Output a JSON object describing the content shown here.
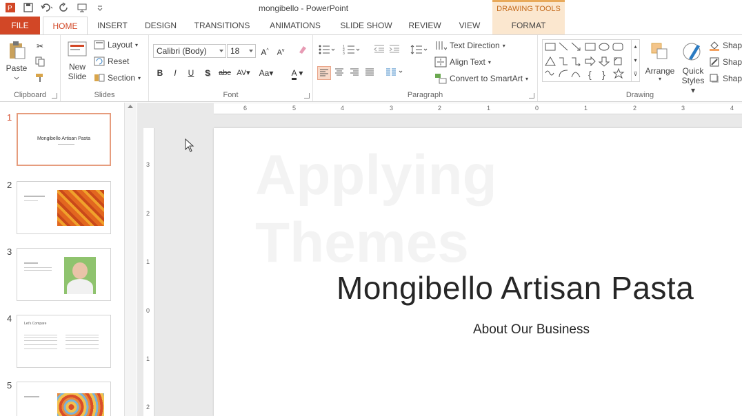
{
  "window": {
    "title": "mongibello - PowerPoint",
    "context_header": "DRAWING TOOLS"
  },
  "tabs": [
    "FILE",
    "HOME",
    "INSERT",
    "DESIGN",
    "TRANSITIONS",
    "ANIMATIONS",
    "SLIDE SHOW",
    "REVIEW",
    "VIEW",
    "FORMAT"
  ],
  "ribbon": {
    "clipboard": {
      "label": "Clipboard",
      "paste": "Paste"
    },
    "slides": {
      "label": "Slides",
      "new_slide_1": "New",
      "new_slide_2": "Slide",
      "layout": "Layout",
      "reset": "Reset",
      "section": "Section"
    },
    "font": {
      "label": "Font",
      "font_name": "Calibri (Body)",
      "font_size": "18",
      "bold": "B",
      "italic": "I",
      "underline": "U",
      "shadow": "S",
      "strike": "abc",
      "spacing": "AV",
      "case": "Aa",
      "color": "A",
      "grow": "A",
      "shrink": "A"
    },
    "paragraph": {
      "label": "Paragraph",
      "text_direction": "Text Direction",
      "align_text": "Align Text",
      "smartart": "Convert to SmartArt"
    },
    "drawing": {
      "label": "Drawing",
      "arrange": "Arrange",
      "quick_1": "Quick",
      "quick_2": "Styles",
      "shape_fill": "Shape",
      "shape_outline": "Shape",
      "shape_effects": "Shape"
    }
  },
  "thumbnails": [
    {
      "num": "1",
      "title": "Mongibello Artisan Pasta"
    },
    {
      "num": "2",
      "title": ""
    },
    {
      "num": "3",
      "title": ""
    },
    {
      "num": "4",
      "title": "Let's Compare"
    },
    {
      "num": "5",
      "title": ""
    }
  ],
  "hruler": [
    "6",
    "5",
    "4",
    "3",
    "2",
    "1",
    "0",
    "1",
    "2",
    "3",
    "4"
  ],
  "vruler": [
    "3",
    "2",
    "1",
    "0",
    "1",
    "2"
  ],
  "slide": {
    "title": "Mongibello Artisan Pasta",
    "subtitle": "About Our Business",
    "watermark_1": "Applying",
    "watermark_2": "Themes"
  }
}
